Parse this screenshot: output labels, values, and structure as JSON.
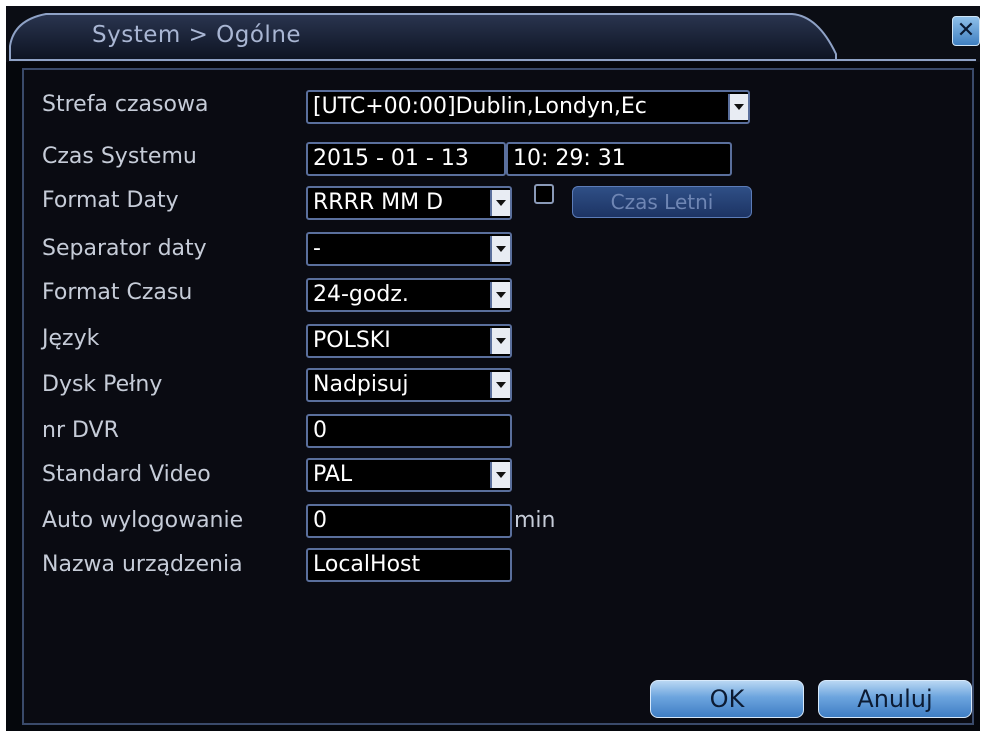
{
  "window": {
    "title": "System > Ogólne",
    "close_icon": "close-icon"
  },
  "form": {
    "timezone": {
      "label": "Strefa czasowa",
      "value": "[UTC+00:00]Dublin,Londyn,Ec"
    },
    "system_time": {
      "label": "Czas Systemu",
      "date": "2015 - 01 - 13",
      "time": "10: 29: 31"
    },
    "date_format": {
      "label": "Format Daty",
      "value": "RRRR MM D",
      "dst_checked": false,
      "dst_button": "Czas Letni"
    },
    "date_separator": {
      "label": "Separator daty",
      "value": "-"
    },
    "time_format": {
      "label": "Format Czasu",
      "value": "24-godz."
    },
    "language": {
      "label": "Język",
      "value": "POLSKI"
    },
    "disk_full": {
      "label": "Dysk Pełny",
      "value": "Nadpisuj"
    },
    "dvr_no": {
      "label": "nr DVR",
      "value": "0"
    },
    "video_standard": {
      "label": "Standard Video",
      "value": "PAL"
    },
    "auto_logout": {
      "label": "Auto wylogowanie",
      "value": "0",
      "unit": "min"
    },
    "device_name": {
      "label": "Nazwa urządzenia",
      "value": "LocalHost"
    }
  },
  "buttons": {
    "ok": "OK",
    "cancel": "Anuluj"
  },
  "colors": {
    "background": "#05070c",
    "field_border": "#5a6f9c",
    "button": "#6ca4de"
  }
}
